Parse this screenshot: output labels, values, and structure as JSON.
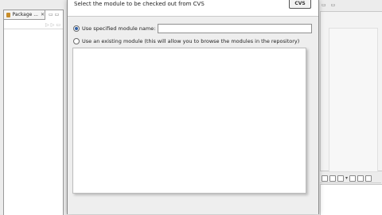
{
  "workspace": {
    "package_tab_label": "Package ...",
    "package_tab_close": "✕",
    "package_minmax": "▭ ▭",
    "package_toolbar": [
      "▷",
      "▷",
      "▭"
    ],
    "right_top_controls": [
      "▭",
      "▭"
    ],
    "right_toolbar_arrow": "▾"
  },
  "dialog": {
    "header_message": "Select the module to be checked out from CVS",
    "logo_text": "CVS",
    "option_specified_label": "Use specified module name:",
    "option_specified_selected": true,
    "module_name_value": "",
    "option_existing_label": "Use an existing module (this will allow you to browse the modules in the repository)",
    "option_existing_selected": false,
    "module_list_items": []
  }
}
